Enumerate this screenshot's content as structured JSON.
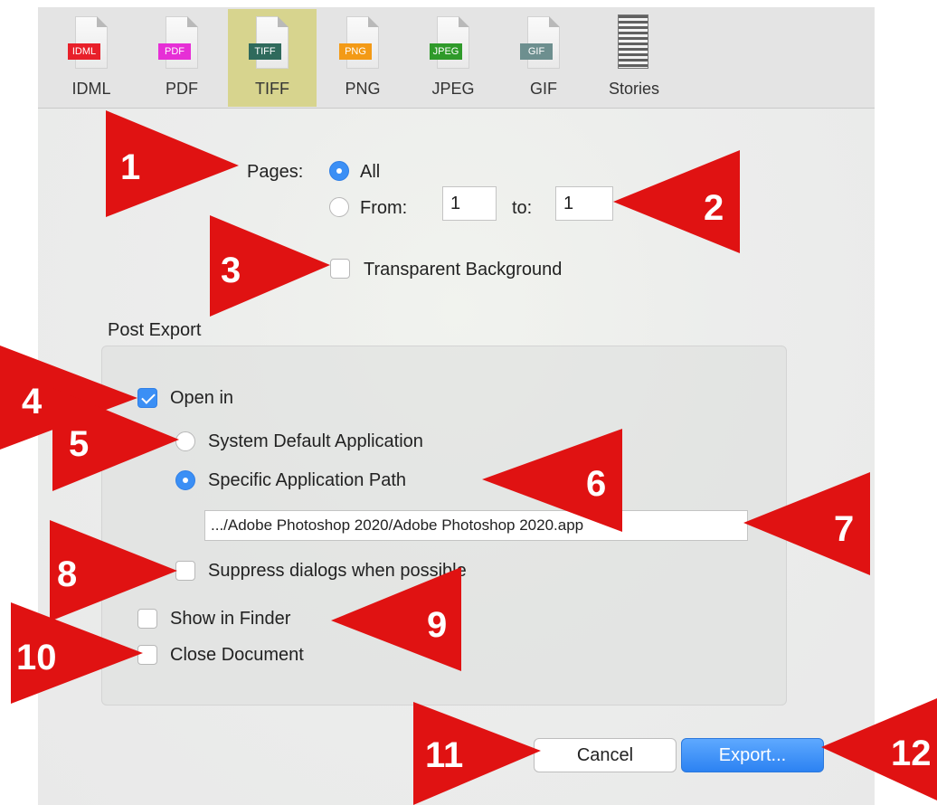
{
  "toolbar": {
    "formats": [
      {
        "tag": "IDML",
        "label": "IDML",
        "color": "#e8202a"
      },
      {
        "tag": "PDF",
        "label": "PDF",
        "color": "#e62fd6"
      },
      {
        "tag": "TIFF",
        "label": "TIFF",
        "color": "#2f6a5c"
      },
      {
        "tag": "PNG",
        "label": "PNG",
        "color": "#f39a16"
      },
      {
        "tag": "JPEG",
        "label": "JPEG",
        "color": "#2f9a2a"
      },
      {
        "tag": "GIF",
        "label": "GIF",
        "color": "#6d8f8f"
      },
      {
        "tag": "",
        "label": "Stories",
        "color": "#606060"
      }
    ],
    "selected": "TIFF"
  },
  "pages": {
    "label": "Pages:",
    "all_label": "All",
    "from_label": "From:",
    "from_value": "1",
    "to_label": "to:",
    "to_value": "1",
    "selected": "All"
  },
  "transparent_background": {
    "label": "Transparent Background",
    "checked": false
  },
  "post_export": {
    "title": "Post Export",
    "open_in": {
      "label": "Open in",
      "checked": true
    },
    "system_default": {
      "label": "System Default Application",
      "selected": false
    },
    "specific_path": {
      "label": "Specific Application Path",
      "selected": true
    },
    "path_value": ".../Adobe Photoshop 2020/Adobe Photoshop 2020.app",
    "suppress_dialogs": {
      "label": "Suppress dialogs when possible",
      "checked": false
    },
    "show_in_finder": {
      "label": "Show in Finder",
      "checked": false
    },
    "close_document": {
      "label": "Close Document",
      "checked": false
    }
  },
  "buttons": {
    "cancel": "Cancel",
    "export": "Export..."
  },
  "callouts": [
    "1",
    "2",
    "3",
    "4",
    "5",
    "6",
    "7",
    "8",
    "9",
    "10",
    "11",
    "12"
  ],
  "colors": {
    "accent": "#3b8ff5",
    "callout": "#e01212",
    "selected_tab": "#d7d48e"
  }
}
